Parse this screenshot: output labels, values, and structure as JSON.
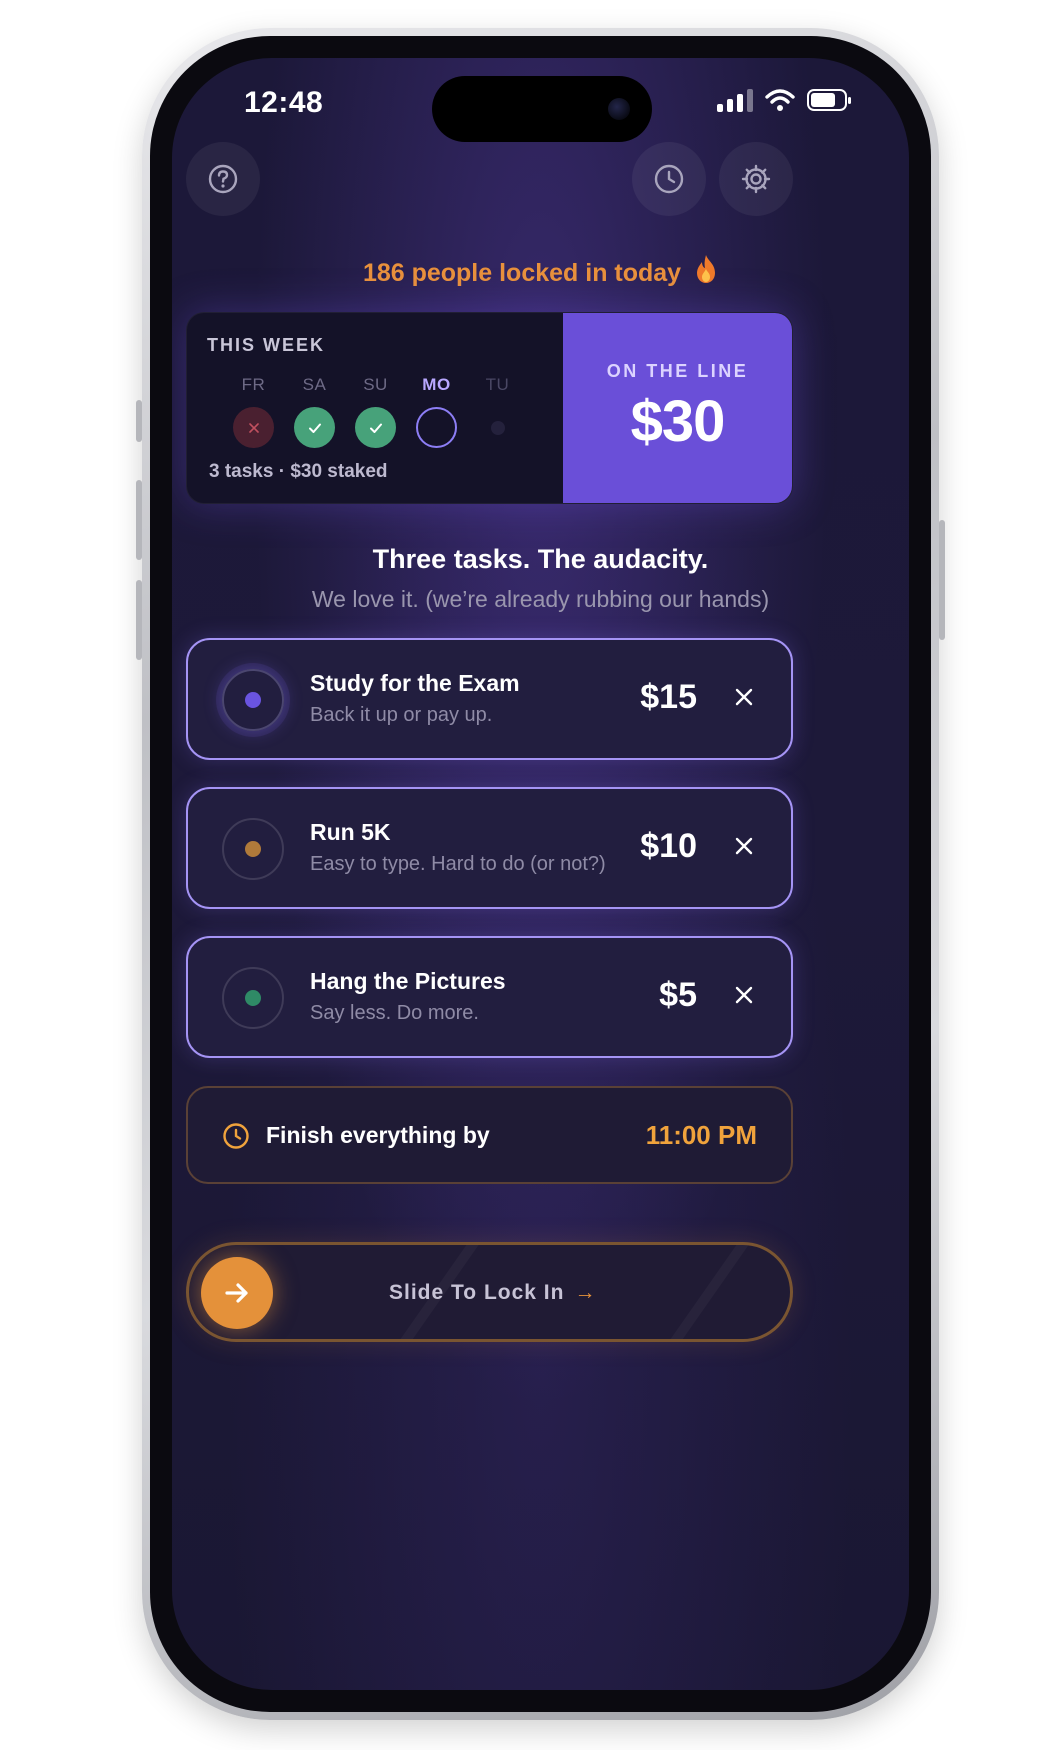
{
  "status_bar": {
    "time": "12:48"
  },
  "locked_banner": {
    "text": "186 people locked in today"
  },
  "week": {
    "title": "THIS WEEK",
    "days": [
      {
        "label": "FR",
        "state": "failed"
      },
      {
        "label": "SA",
        "state": "done"
      },
      {
        "label": "SU",
        "state": "done"
      },
      {
        "label": "MO",
        "state": "today"
      },
      {
        "label": "TU",
        "state": "future"
      }
    ],
    "summary": "3 tasks · $30 staked",
    "on_the_line_label": "ON THE LINE",
    "on_the_line_amount": "$30"
  },
  "headline": "Three tasks. The audacity.",
  "subline": "We love it. (we’re already rubbing our hands)",
  "tasks": [
    {
      "title": "Study for the Exam",
      "subtitle": "Back it up or pay up.",
      "amount": "$15",
      "color": "#6a54e0"
    },
    {
      "title": "Run 5K",
      "subtitle": "Easy to type. Hard to do (or not?)",
      "amount": "$10",
      "color": "#b07a3a"
    },
    {
      "title": "Hang the Pictures",
      "subtitle": "Say less. Do more.",
      "amount": "$5",
      "color": "#2f8a66"
    }
  ],
  "deadline": {
    "label": "Finish everything by",
    "time": "11:00 PM"
  },
  "slider": {
    "label": "Slide To Lock In",
    "arrow": "→"
  },
  "colors": {
    "accent": "#6a4fd8",
    "orange": "#e4913a",
    "background": "#1c1839"
  }
}
